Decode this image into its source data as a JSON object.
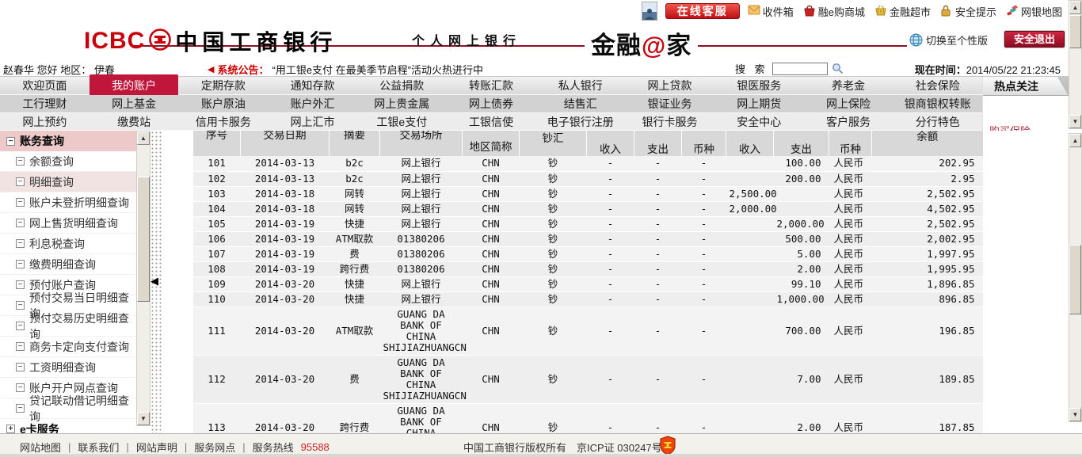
{
  "colors": {
    "icbc_red": "#c7000b",
    "active_tab_red": "#c0163c",
    "announcement_red": "#cc0000",
    "hot_link_red": "#b03344",
    "hotline_red": "#cc2222"
  },
  "topbar": {
    "online_service_label": "在线客服",
    "quick_links": [
      {
        "icon": "inbox-icon",
        "label": "收件箱"
      },
      {
        "icon": "shopping-bag-icon",
        "label": "融e购商城"
      },
      {
        "icon": "basket-icon",
        "label": "金融超市"
      },
      {
        "icon": "lock-icon",
        "label": "安全提示"
      },
      {
        "icon": "map-icon",
        "label": "网银地图"
      }
    ]
  },
  "header": {
    "logo_text": "ICBC",
    "bank_name": "中国工商银行",
    "subtitle": "个人网上银行",
    "brand_prefix": "金融",
    "brand_at": "@",
    "brand_suffix": "家",
    "switch_label": "切换至个性版",
    "logout_label": "安全退出"
  },
  "userbar": {
    "greeting": "赵春华 您好 地区： 伊春",
    "announcement_label": "系统公告：",
    "announcement_text": "“用工银e支付 在最美季节启程”活动火热进行中",
    "search_label": "搜 索",
    "search_value": "",
    "time_label": "现在时间：",
    "time_value": "2014/05/22 21:23:45"
  },
  "nav": {
    "active": "我的账户",
    "rows": [
      [
        "欢迎页面",
        "我的账户",
        "定期存款",
        "通知存款",
        "公益捐款",
        "转账汇款",
        "私人银行",
        "网上贷款",
        "银医服务",
        "养老金",
        "社会保险"
      ],
      [
        "工行理财",
        "网上基金",
        "账户原油",
        "账户外汇",
        "网上贵金属",
        "网上债券",
        "结售汇",
        "银证业务",
        "网上期货",
        "网上保险",
        "银商银权转账"
      ],
      [
        "网上预约",
        "缴费站",
        "信用卡服务",
        "网上汇市",
        "工银e支付",
        "工银信使",
        "电子银行注册",
        "银行卡服务",
        "安全中心",
        "客户服务",
        "分行特色"
      ]
    ]
  },
  "hot_panel": {
    "title": "热点关注",
    "links": [
      "购买保险"
    ]
  },
  "sidebar": {
    "items": [
      {
        "label": "账务查询",
        "type": "section",
        "expanded": true
      },
      {
        "label": "余额查询",
        "type": "item"
      },
      {
        "label": "明细查询",
        "type": "item",
        "selected": true
      },
      {
        "label": "账户未登折明细查询",
        "type": "item"
      },
      {
        "label": "网上售货明细查询",
        "type": "item"
      },
      {
        "label": "利息税查询",
        "type": "item"
      },
      {
        "label": "缴费明细查询",
        "type": "item"
      },
      {
        "label": "预付账户查询",
        "type": "item"
      },
      {
        "label": "预付交易当日明细查询",
        "type": "item"
      },
      {
        "label": "预付交易历史明细查询",
        "type": "item"
      },
      {
        "label": "商务卡定向支付查询",
        "type": "item"
      },
      {
        "label": "工资明细查询",
        "type": "item"
      },
      {
        "label": "账户开户网点查询",
        "type": "item"
      },
      {
        "label": "贷记联动借记明细查询",
        "type": "item"
      },
      {
        "label": "e卡服务",
        "type": "section",
        "expanded": false
      }
    ]
  },
  "transactions": {
    "headers": [
      "序号",
      "交易日期",
      "摘要",
      "交易场所",
      "地区简称",
      "钞汇",
      "收入",
      "支出",
      "币种",
      "收入",
      "支出",
      "币种",
      "余额"
    ],
    "rows": [
      [
        "101",
        "2014-03-13",
        "b2c",
        "网上银行",
        "CHN",
        "钞",
        "-",
        "-",
        "-",
        "",
        "100.00",
        "人民币",
        "202.95"
      ],
      [
        "102",
        "2014-03-13",
        "b2c",
        "网上银行",
        "CHN",
        "钞",
        "-",
        "-",
        "-",
        "",
        "200.00",
        "人民币",
        "2.95"
      ],
      [
        "103",
        "2014-03-18",
        "网转",
        "网上银行",
        "CHN",
        "钞",
        "-",
        "-",
        "-",
        "2,500.00",
        "",
        "人民币",
        "2,502.95"
      ],
      [
        "104",
        "2014-03-18",
        "网转",
        "网上银行",
        "CHN",
        "钞",
        "-",
        "-",
        "-",
        "2,000.00",
        "",
        "人民币",
        "4,502.95"
      ],
      [
        "105",
        "2014-03-19",
        "快捷",
        "网上银行",
        "CHN",
        "钞",
        "-",
        "-",
        "-",
        "",
        "2,000.00",
        "人民币",
        "2,502.95"
      ],
      [
        "106",
        "2014-03-19",
        "ATM取款",
        "01380206",
        "CHN",
        "钞",
        "-",
        "-",
        "-",
        "",
        "500.00",
        "人民币",
        "2,002.95"
      ],
      [
        "107",
        "2014-03-19",
        "费",
        "01380206",
        "CHN",
        "钞",
        "-",
        "-",
        "-",
        "",
        "5.00",
        "人民币",
        "1,997.95"
      ],
      [
        "108",
        "2014-03-19",
        "跨行费",
        "01380206",
        "CHN",
        "钞",
        "-",
        "-",
        "-",
        "",
        "2.00",
        "人民币",
        "1,995.95"
      ],
      [
        "109",
        "2014-03-20",
        "快捷",
        "网上银行",
        "CHN",
        "钞",
        "-",
        "-",
        "-",
        "",
        "99.10",
        "人民币",
        "1,896.85"
      ],
      [
        "110",
        "2014-03-20",
        "快捷",
        "网上银行",
        "CHN",
        "钞",
        "-",
        "-",
        "-",
        "",
        "1,000.00",
        "人民币",
        "896.85"
      ],
      [
        "111",
        "2014-03-20",
        "ATM取款",
        "GUANG DA BANK OF\nCHINA\nSHIJIAZHUANGCN",
        "CHN",
        "钞",
        "-",
        "-",
        "-",
        "",
        "700.00",
        "人民币",
        "196.85"
      ],
      [
        "112",
        "2014-03-20",
        "费",
        "GUANG DA BANK OF\nCHINA\nSHIJIAZHUANGCN",
        "CHN",
        "钞",
        "-",
        "-",
        "-",
        "",
        "7.00",
        "人民币",
        "189.85"
      ],
      [
        "113",
        "2014-03-20",
        "跨行费",
        "GUANG DA BANK OF\nCHINA\nSHIJIAZHUANGCN",
        "CHN",
        "钞",
        "-",
        "-",
        "-",
        "",
        "2.00",
        "人民币",
        "187.85"
      ]
    ]
  },
  "footer": {
    "links": [
      "网站地图",
      "联系我们",
      "网站声明",
      "服务网点"
    ],
    "hotline_label": "服务热线",
    "hotline_number": "95588",
    "copyright": "中国工商银行版权所有　京ICP证 030247号"
  }
}
